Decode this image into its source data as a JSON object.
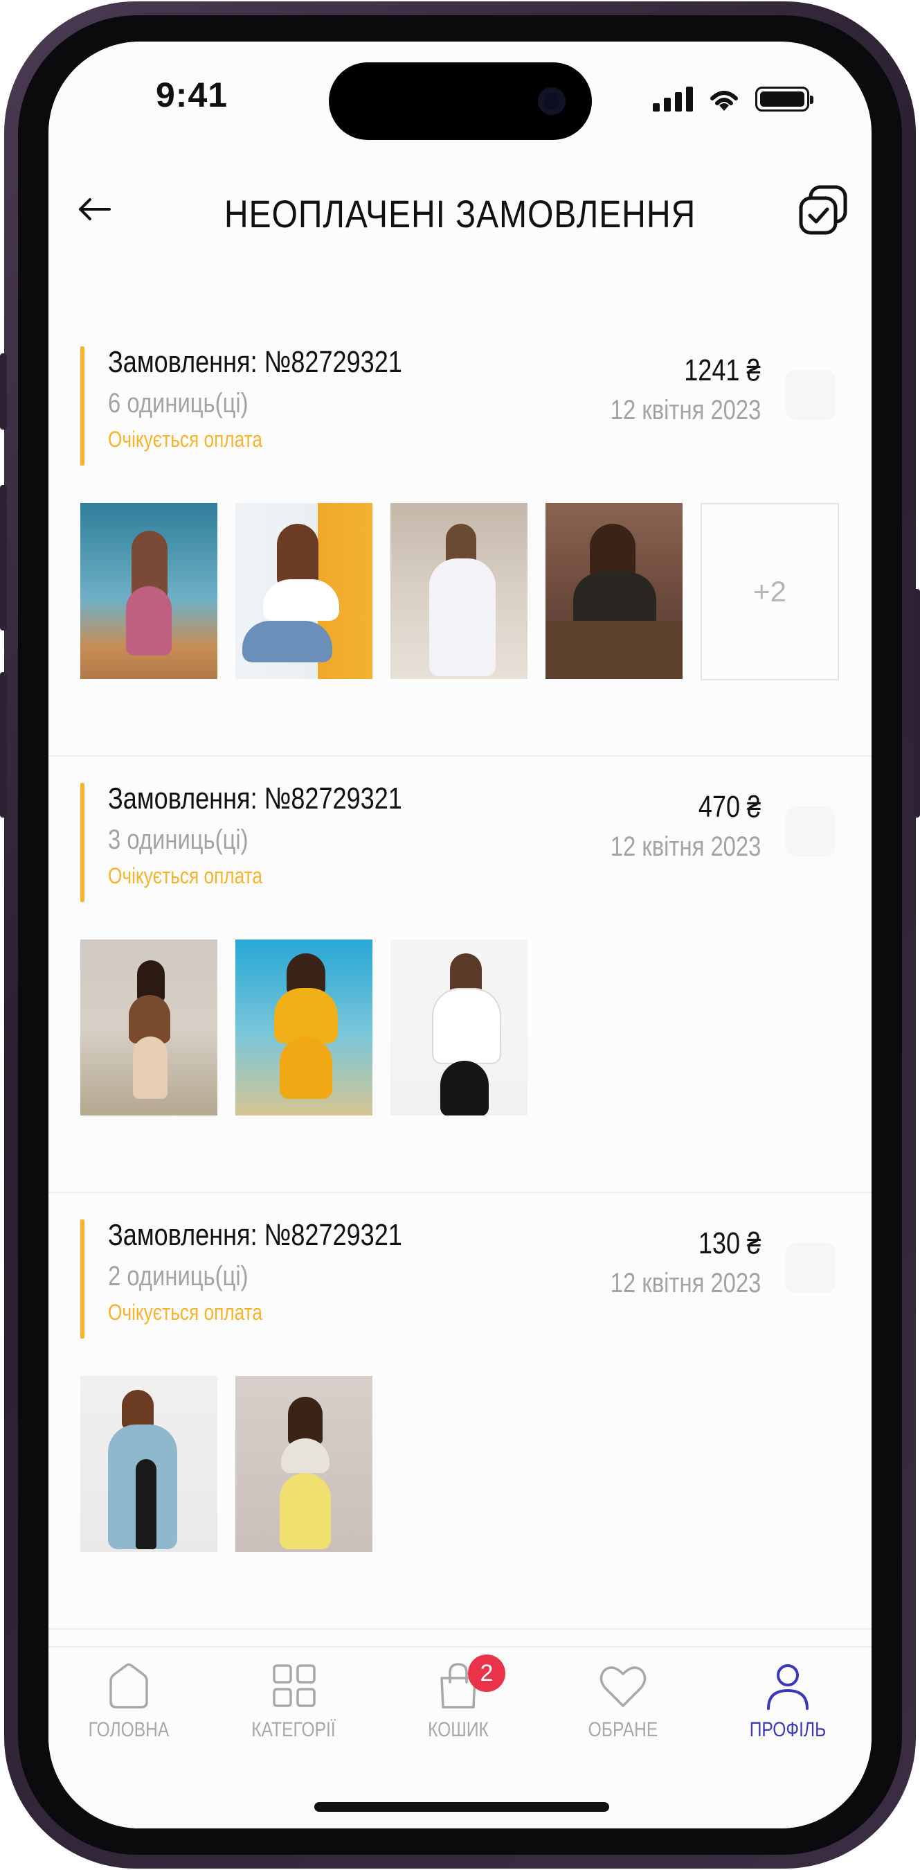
{
  "status_bar": {
    "time": "9:41"
  },
  "header": {
    "title": "НЕОПЛАЧЕНІ ЗАМОВЛЕННЯ"
  },
  "orders": [
    {
      "number": "Замовлення: №82729321",
      "quantity": "6 одиниць(ці)",
      "status": "Очікується оплата",
      "price": "1241 ₴",
      "date": "12 квітня 2023",
      "more_label": "+2"
    },
    {
      "number": "Замовлення: №82729321",
      "quantity": "3 одиниць(ці)",
      "status": "Очікується оплата",
      "price": "470 ₴",
      "date": "12 квітня 2023"
    },
    {
      "number": "Замовлення: №82729321",
      "quantity": "2 одиниць(ці)",
      "status": "Очікується оплата",
      "price": "130 ₴",
      "date": "12 квітня 2023"
    }
  ],
  "tabbar": {
    "items": [
      {
        "label": "ГОЛОВНА",
        "icon": "home-icon"
      },
      {
        "label": "КАТЕГОРІЇ",
        "icon": "grid-icon"
      },
      {
        "label": "КОШИК",
        "icon": "bag-icon",
        "badge": "2"
      },
      {
        "label": "ОБРАНЕ",
        "icon": "heart-icon"
      },
      {
        "label": "ПРОФІЛЬ",
        "icon": "user-icon",
        "active": true
      }
    ]
  },
  "colors": {
    "accent": "#f5b32e",
    "active_tab": "#3a3ab8",
    "badge": "#e8334a"
  }
}
